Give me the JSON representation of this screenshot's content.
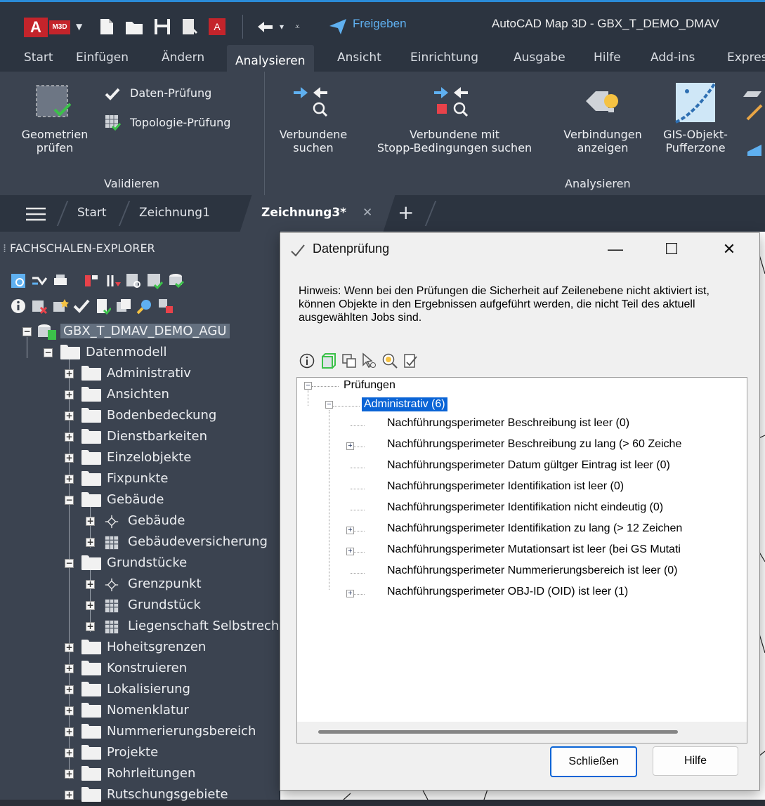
{
  "titlebar": {
    "logo_letter": "A",
    "product_badge": "M3D",
    "share_label": "Freigeben",
    "app_title": "AutoCAD Map 3D - GBX_T_DEMO_DMAV"
  },
  "ribbon_tabs": [
    "Start",
    "Einfügen",
    "Ändern",
    "Analysieren",
    "Ansicht",
    "Einrichtung",
    "Ausgabe",
    "Hilfe",
    "Add-ins",
    "Expres"
  ],
  "ribbon": {
    "check_geometry": [
      "Geometrien",
      "prüfen"
    ],
    "data_check": "Daten-Prüfung",
    "topology_check": "Topologie-Prüfung",
    "panel_validate": "Validieren",
    "connected_search": [
      "Verbundene",
      "suchen"
    ],
    "connected_stop_search": [
      "Verbundene mit",
      "Stopp-Bedingungen suchen"
    ],
    "show_connections": [
      "Verbindungen",
      "anzeigen"
    ],
    "buffer": [
      "GIS-Objekt-",
      "Pufferzone"
    ],
    "panel_analyze": "Analysieren"
  },
  "filetabs": {
    "start": "Start",
    "drawing1": "Zeichnung1",
    "drawing3": "Zeichnung3*"
  },
  "explorer": {
    "title": "FACHSCHALEN-EXPLORER",
    "root": "GBX_T_DMAV_DEMO_AGU",
    "datamodel": "Datenmodell",
    "items": [
      {
        "label": "Administrativ",
        "level": 2,
        "kind": "folder",
        "exp": "+"
      },
      {
        "label": "Ansichten",
        "level": 2,
        "kind": "folder",
        "exp": "+"
      },
      {
        "label": "Bodenbedeckung",
        "level": 2,
        "kind": "folder",
        "exp": "+"
      },
      {
        "label": "Dienstbarkeiten",
        "level": 2,
        "kind": "folder",
        "exp": "+"
      },
      {
        "label": "Einzelobjekte",
        "level": 2,
        "kind": "folder",
        "exp": "+"
      },
      {
        "label": "Fixpunkte",
        "level": 2,
        "kind": "folder",
        "exp": "+"
      },
      {
        "label": "Gebäude",
        "level": 2,
        "kind": "folder",
        "exp": "-"
      },
      {
        "label": "Gebäude",
        "level": 3,
        "kind": "point",
        "exp": "+"
      },
      {
        "label": "Gebäudeversicherung",
        "level": 3,
        "kind": "table",
        "exp": "+"
      },
      {
        "label": "Grundstücke",
        "level": 2,
        "kind": "folder",
        "exp": "-"
      },
      {
        "label": "Grenzpunkt",
        "level": 3,
        "kind": "point",
        "exp": "+"
      },
      {
        "label": "Grundstück",
        "level": 3,
        "kind": "table",
        "exp": "+"
      },
      {
        "label": "Liegenschaft Selbstrech",
        "level": 3,
        "kind": "table",
        "exp": "+"
      },
      {
        "label": "Hoheitsgrenzen",
        "level": 2,
        "kind": "folder",
        "exp": "+"
      },
      {
        "label": "Konstruieren",
        "level": 2,
        "kind": "folder",
        "exp": "+"
      },
      {
        "label": "Lokalisierung",
        "level": 2,
        "kind": "folder",
        "exp": "+"
      },
      {
        "label": "Nomenklatur",
        "level": 2,
        "kind": "folder",
        "exp": "+"
      },
      {
        "label": "Nummerierungsbereich",
        "level": 2,
        "kind": "folder",
        "exp": "+"
      },
      {
        "label": "Projekte",
        "level": 2,
        "kind": "folder",
        "exp": "+"
      },
      {
        "label": "Rohrleitungen",
        "level": 2,
        "kind": "folder",
        "exp": "+"
      },
      {
        "label": "Rutschungsgebiete",
        "level": 2,
        "kind": "folder",
        "exp": "+"
      }
    ]
  },
  "dialog": {
    "title": "Datenprüfung",
    "hint": "Hinweis: Wenn bei den Prüfungen die Sicherheit auf Zeilenebene nicht aktiviert ist, können Objekte in den Ergebnissen aufgeführt werden, die nicht Teil des aktuell ausgewählten Jobs sind.",
    "root": "Prüfungen",
    "group": "Administrativ (6)",
    "checks": [
      {
        "label": "Nachführungsperimeter Beschreibung ist leer (0)",
        "expandable": false
      },
      {
        "label": "Nachführungsperimeter Beschreibung zu lang (> 60 Zeiche",
        "expandable": true
      },
      {
        "label": "Nachführungsperimeter Datum gültger Eintrag ist leer (0)",
        "expandable": false
      },
      {
        "label": "Nachführungsperimeter Identifikation ist leer (0)",
        "expandable": false
      },
      {
        "label": "Nachführungsperimeter Identifikation nicht eindeutig (0)",
        "expandable": false
      },
      {
        "label": "Nachführungsperimeter Identifikation zu lang (> 12 Zeichen",
        "expandable": true
      },
      {
        "label": "Nachführungsperimeter Mutationsart ist leer (bei GS Mutati",
        "expandable": true
      },
      {
        "label": "Nachführungsperimeter Nummerierungsbereich ist leer (0)",
        "expandable": false
      },
      {
        "label": "Nachführungsperimeter OBJ-ID (OID) ist leer (1)",
        "expandable": true
      }
    ],
    "close_label": "Schließen",
    "help_label": "Hilfe"
  },
  "colors": {
    "accent": "#0a64d6",
    "app_red": "#c4242b",
    "ribbon_bg": "#3b4350",
    "chrome_bg": "#2c3440"
  }
}
